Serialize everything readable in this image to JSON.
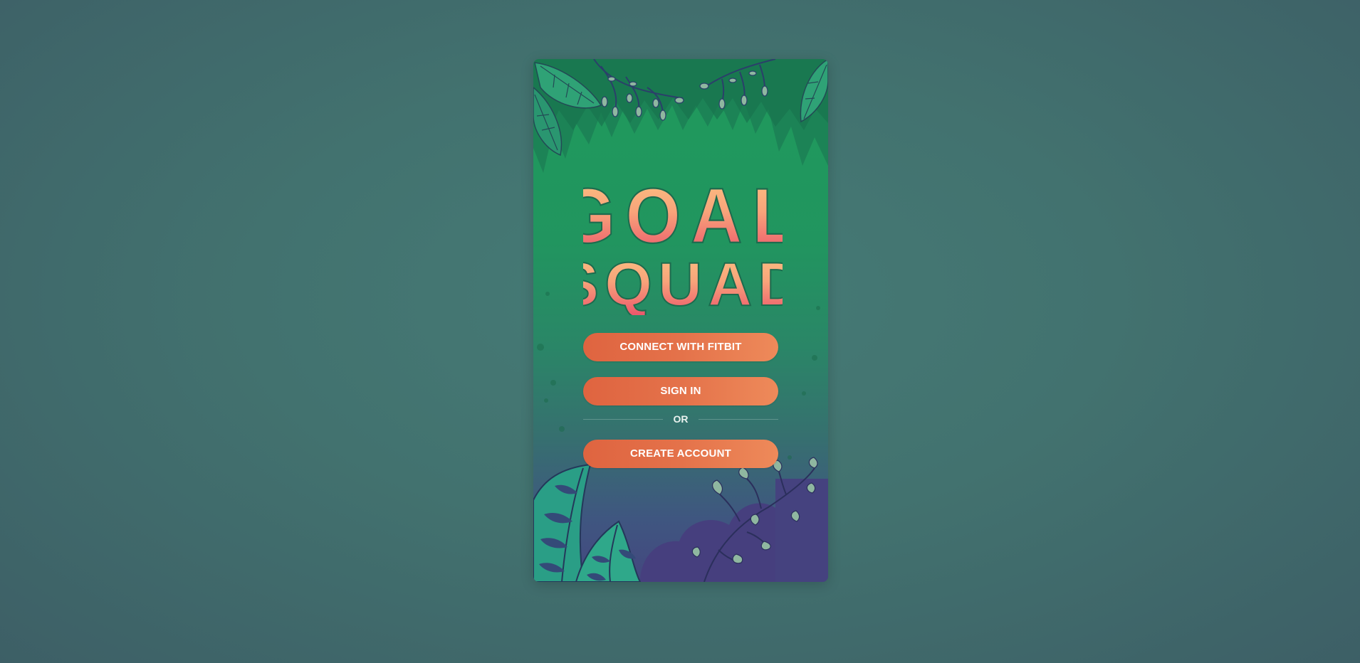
{
  "app": {
    "logo_line1": "GOAL",
    "logo_line2": "SQUAD"
  },
  "actions": {
    "connect_fitbit_label": "CONNECT WITH FITBIT",
    "sign_in_label": "SIGN IN",
    "divider_label": "OR",
    "create_account_label": "CREATE ACCOUNT"
  },
  "colors": {
    "button": "#e4724a",
    "logo_top": "#fbc383",
    "logo_bottom": "#ea4f6a",
    "panel_green": "#1f9a5c",
    "panel_purple": "#44477f"
  }
}
